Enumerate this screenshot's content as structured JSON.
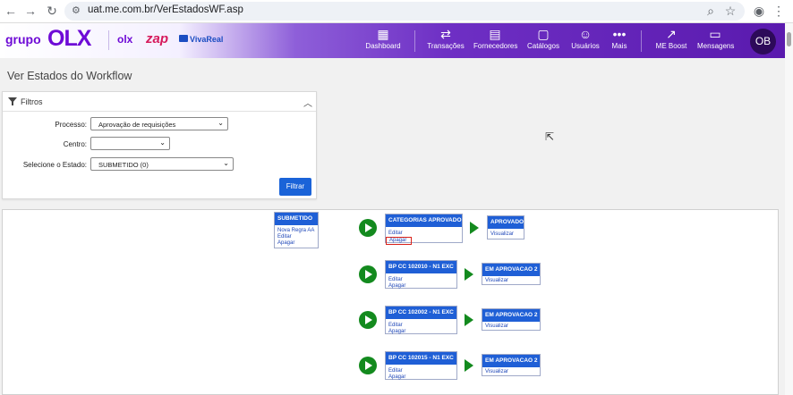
{
  "browser": {
    "url": "uat.me.com.br/VerEstadosWF.asp",
    "icons": [
      "back-icon",
      "forward-icon",
      "reload-icon",
      "site-settings-icon",
      "zoom-icon",
      "bookmark-star-icon",
      "profile-icon",
      "more-vert-icon"
    ]
  },
  "header": {
    "brand": {
      "grupo": "grupo",
      "olx": "OLX",
      "olx_small": "olx",
      "zap": "zap",
      "vivareal": "VivaReal"
    },
    "nav": [
      {
        "label": "Dashboard",
        "icon": "dashboard-icon"
      },
      {
        "label": "Transações",
        "icon": "transactions-icon"
      },
      {
        "label": "Fornecedores",
        "icon": "suppliers-icon"
      },
      {
        "label": "Catálogos",
        "icon": "catalog-icon"
      },
      {
        "label": "Usuários",
        "icon": "users-icon"
      },
      {
        "label": "Mais",
        "icon": "more-icon"
      },
      {
        "label": "ME Boost",
        "icon": "chart-icon"
      },
      {
        "label": "Mensagens",
        "icon": "chat-icon"
      }
    ],
    "avatar": "OB"
  },
  "page": {
    "title": "Ver Estados do Workflow"
  },
  "filters": {
    "title": "Filtros",
    "processo_label": "Processo:",
    "processo_value": "Aprovação de requisições",
    "centro_label": "Centro:",
    "centro_value": "",
    "estado_label": "Selecione o Estado:",
    "estado_value": "SUBMETIDO (0)",
    "button": "Filtrar"
  },
  "workflow": {
    "start": {
      "title": "SUBMETIDO",
      "links": [
        "Nova Regra AA",
        "Editar",
        "Apagar"
      ]
    },
    "rules": [
      {
        "title": "CATEGORIAS APROVADO",
        "links": [
          "Editar",
          "Apagar"
        ],
        "target": "APROVADO",
        "target_link": "Visualizar"
      },
      {
        "title": "BP CC 102010 - N1 EXC",
        "links": [
          "Editar",
          "Apagar"
        ],
        "target": "EM APROVACAO 2",
        "target_link": "Visualizar"
      },
      {
        "title": "BP CC 102002 - N1 EXC",
        "links": [
          "Editar",
          "Apagar"
        ],
        "target": "EM APROVACAO 2",
        "target_link": "Visualizar"
      },
      {
        "title": "BP CC 102015 - N1 EXC",
        "links": [
          "Editar",
          "Apagar"
        ],
        "target": "EM APROVACAO 2",
        "target_link": "Visualizar"
      }
    ]
  },
  "colors": {
    "accent": "#1f5fd6",
    "play": "#138a1e",
    "header": "#6e2fc4",
    "highlight": "#d9221a"
  }
}
